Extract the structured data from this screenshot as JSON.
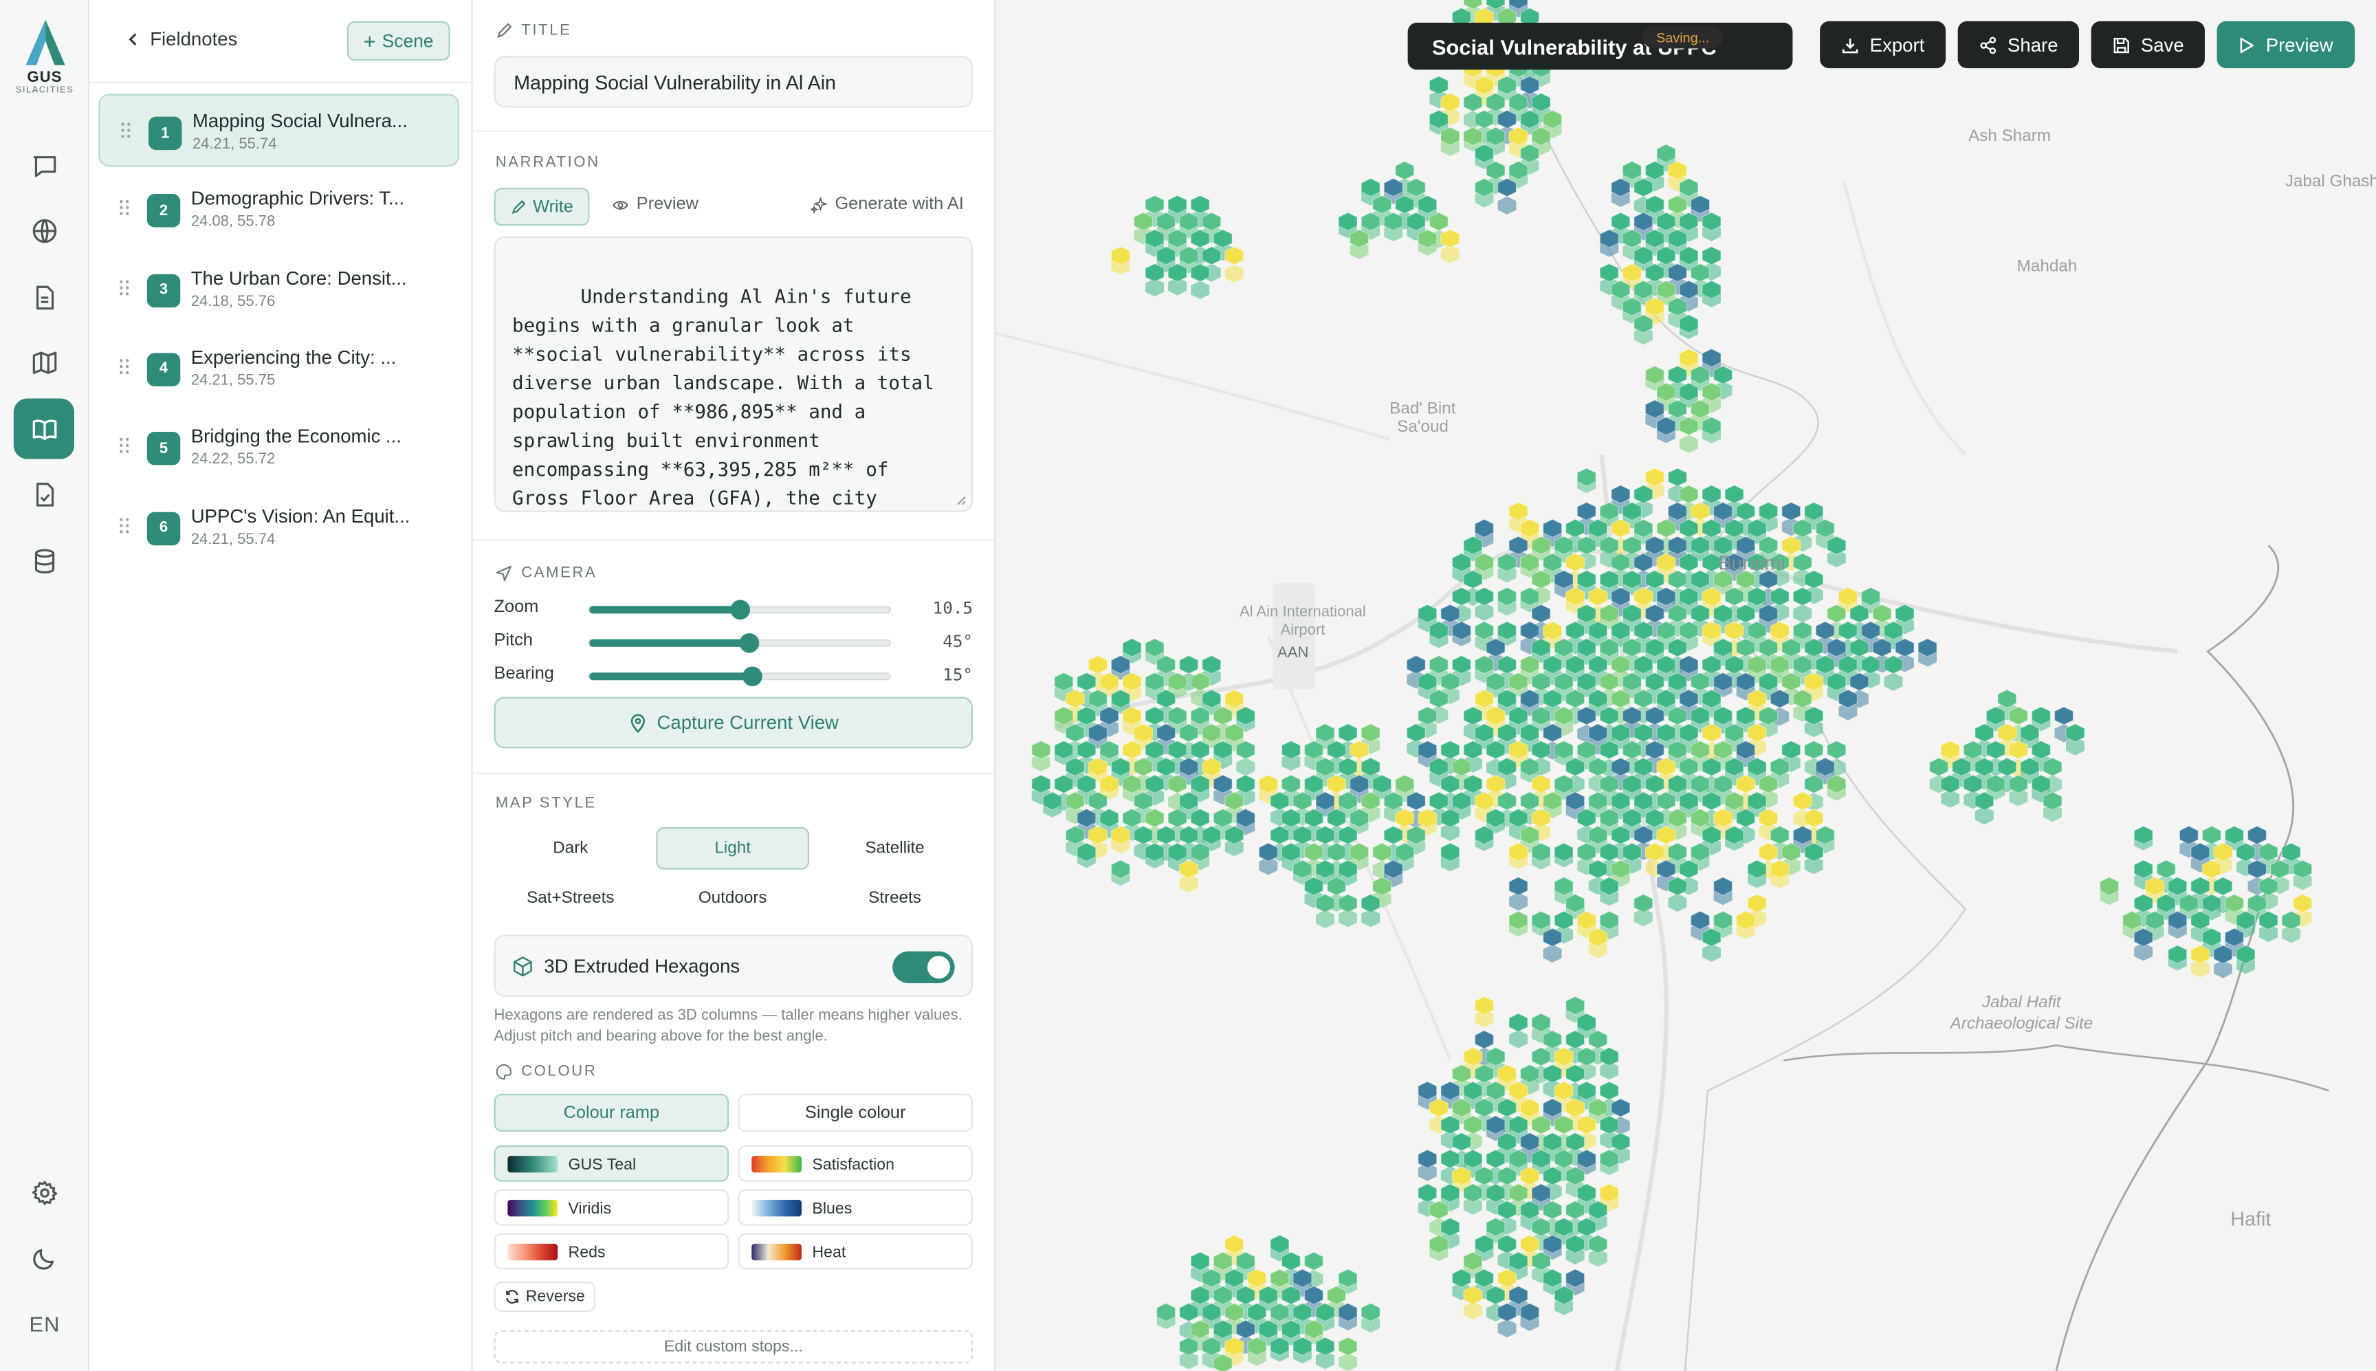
{
  "brand": {
    "name": "GUS",
    "sub": "SILACITIES"
  },
  "rail": {
    "items": [
      "chat-icon",
      "globe-icon",
      "document-icon",
      "map-icon",
      "book-open-icon",
      "checklist-icon",
      "database-icon"
    ],
    "active": "book-open-icon",
    "bottom": [
      "settings-icon",
      "moon-icon"
    ],
    "language": "EN"
  },
  "scenes": {
    "back_label": "Fieldnotes",
    "add_label": "Scene",
    "items": [
      {
        "num": "1",
        "title": "Mapping Social Vulnera...",
        "coords": "24.21, 55.74",
        "active": true
      },
      {
        "num": "2",
        "title": "Demographic Drivers: T...",
        "coords": "24.08, 55.78"
      },
      {
        "num": "3",
        "title": "The Urban Core: Densit...",
        "coords": "24.18, 55.76"
      },
      {
        "num": "4",
        "title": "Experiencing the City: ...",
        "coords": "24.21, 55.75"
      },
      {
        "num": "5",
        "title": "Bridging the Economic ...",
        "coords": "24.22, 55.72"
      },
      {
        "num": "6",
        "title": "UPPC's Vision: An Equit...",
        "coords": "24.21, 55.74"
      }
    ]
  },
  "editor": {
    "title_label": "TITLE",
    "title_value": "Mapping Social Vulnerability in Al Ain",
    "narration_label": "NARRATION",
    "tab_write": "Write",
    "tab_preview": "Preview",
    "tab_ai": "Generate with AI",
    "narration_text": "Understanding Al Ain's future begins with a granular look at **social vulnerability** across its diverse urban landscape. With a total population of **986,895** and a sprawling built environment encompassing **63,395,285 m²** of Gross Floor Area (GFA), the city presents a complex tapestry of demographic and economic realities.",
    "camera_label": "CAMERA",
    "camera": [
      {
        "label": "Zoom",
        "value": "10.5",
        "fraction": 0.5
      },
      {
        "label": "Pitch",
        "value": "45°",
        "fraction": 0.53
      },
      {
        "label": "Bearing",
        "value": "15°",
        "fraction": 0.54
      }
    ],
    "capture_label": "Capture Current View",
    "map_style_label": "MAP STYLE",
    "map_styles": [
      "Dark",
      "Light",
      "Satellite",
      "Sat+Streets",
      "Outdoors",
      "Streets"
    ],
    "map_style_active": "Light",
    "hex_label": "3D Extruded Hexagons",
    "hex_enabled": true,
    "hex_hint": "Hexagons are rendered as 3D columns — taller means higher values. Adjust pitch and bearing above for the best angle.",
    "colour_label": "COLOUR",
    "colour_modes": [
      "Colour ramp",
      "Single colour"
    ],
    "colour_mode_active": "Colour ramp",
    "ramps": [
      {
        "name": "GUS Teal",
        "active": true
      },
      {
        "name": "Satisfaction"
      },
      {
        "name": "Viridis"
      },
      {
        "name": "Blues"
      },
      {
        "name": "Reds"
      },
      {
        "name": "Heat"
      }
    ],
    "reverse_label": "Reverse",
    "custom_label": "Edit custom stops..."
  },
  "map": {
    "title": "Social Vulnerability at UPPC",
    "saving": "Saving...",
    "export_label": "Export",
    "share_label": "Share",
    "save_label": "Save",
    "preview_label": "Preview",
    "labels": {
      "ash_sharm": "Ash Sharm",
      "jabal_ghashna": "Jabal Ghashna",
      "mahdah": "Mahdah",
      "bad_bint": "Bad' Bint",
      "saoud": "Sa'oud",
      "buraimi": "Buraimi",
      "airport1": "Al Ain International",
      "airport2": "Airport",
      "aan": "AAN",
      "jabal_hafit1": "Jabal Hafit",
      "jabal_hafit2": "Archaeological Site",
      "hafit": "Hafit"
    },
    "colors": {
      "teal": "#3fb886",
      "green": "#56c289",
      "yellow": "#f2e14a",
      "blue": "#3f7fa0"
    }
  }
}
